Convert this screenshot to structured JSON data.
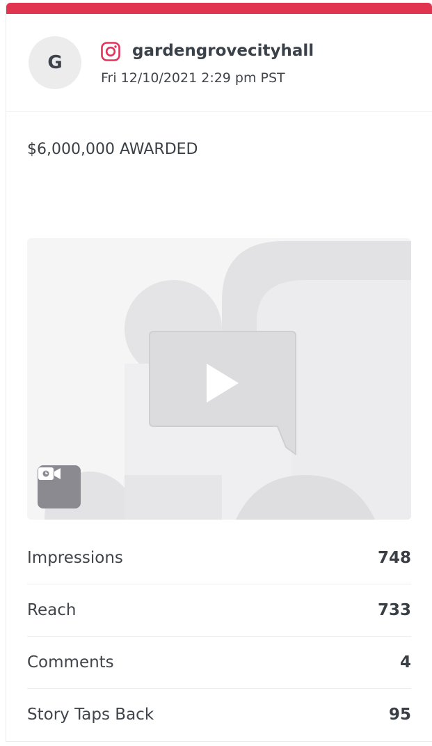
{
  "theme": {
    "accent": "#e0344f",
    "instagram": "#e2335b"
  },
  "post": {
    "avatar_initial": "G",
    "platform_icon": "instagram-icon",
    "username": "gardengrovecityhall",
    "timestamp": "Fri 12/10/2021 2:29 pm PST",
    "caption": "$6,000,000 AWARDED",
    "media_type_icon": "video-camera-icon",
    "media_placeholder_icon": "play-icon"
  },
  "stats": [
    {
      "label": "Impressions",
      "value": "748"
    },
    {
      "label": "Reach",
      "value": "733"
    },
    {
      "label": "Comments",
      "value": "4"
    },
    {
      "label": "Story Taps Back",
      "value": "95"
    }
  ]
}
